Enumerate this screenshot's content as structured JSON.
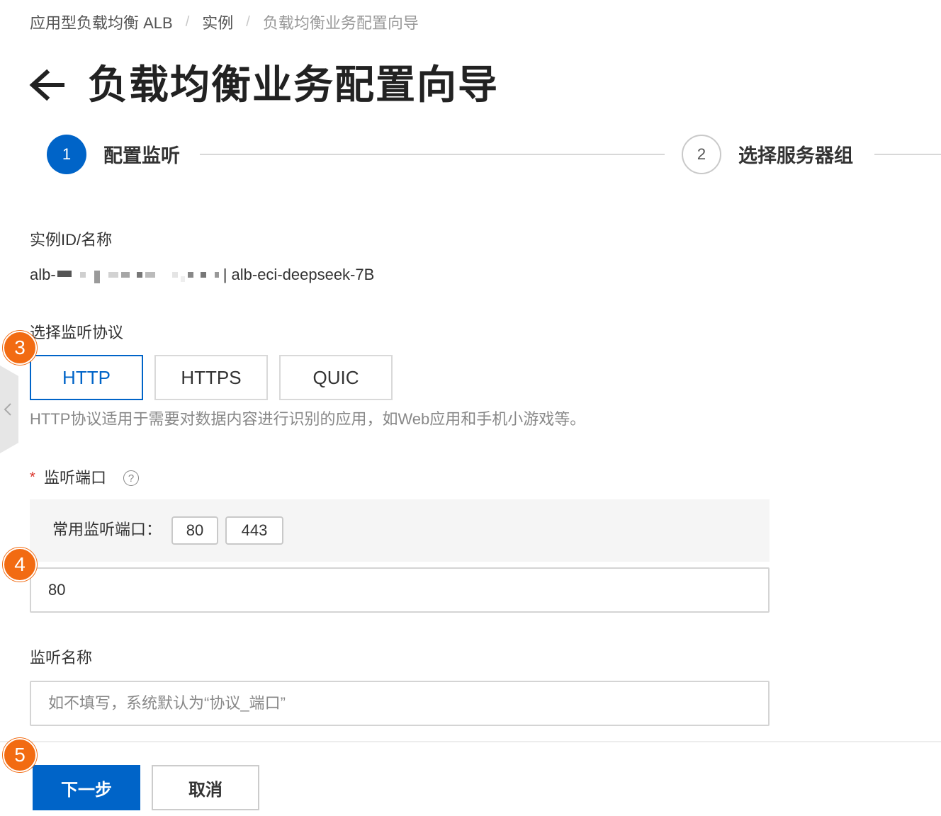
{
  "breadcrumb": {
    "items": [
      "应用型负载均衡 ALB",
      "实例",
      "负载均衡业务配置向导"
    ],
    "separator": "/"
  },
  "page": {
    "title": "负载均衡业务配置向导"
  },
  "steps": [
    {
      "number": "1",
      "label": "配置监听",
      "state": "active"
    },
    {
      "number": "2",
      "label": "选择服务器组",
      "state": "inactive"
    }
  ],
  "instance": {
    "label": "实例ID/名称",
    "id_prefix": "alb-",
    "name_suffix": "| alb-eci-deepseek-7B"
  },
  "protocol": {
    "label": "选择监听协议",
    "options": [
      "HTTP",
      "HTTPS",
      "QUIC"
    ],
    "selected": "HTTP",
    "description": "HTTP协议适用于需要对数据内容进行识别的应用，如Web应用和手机小游戏等。"
  },
  "port": {
    "required_mark": "*",
    "label": "监听端口",
    "help_icon": "?",
    "common_title": "常用监听端口：",
    "common_ports": [
      "80",
      "443"
    ],
    "value": "80"
  },
  "listener_name": {
    "label": "监听名称",
    "placeholder": "如不填写，系统默认为“协议_端口”",
    "value": ""
  },
  "footer": {
    "next_label": "下一步",
    "cancel_label": "取消"
  },
  "markers": [
    "3",
    "4",
    "5"
  ],
  "colors": {
    "primary": "#0064c8",
    "marker": "#f26b12",
    "required": "#d93026"
  }
}
